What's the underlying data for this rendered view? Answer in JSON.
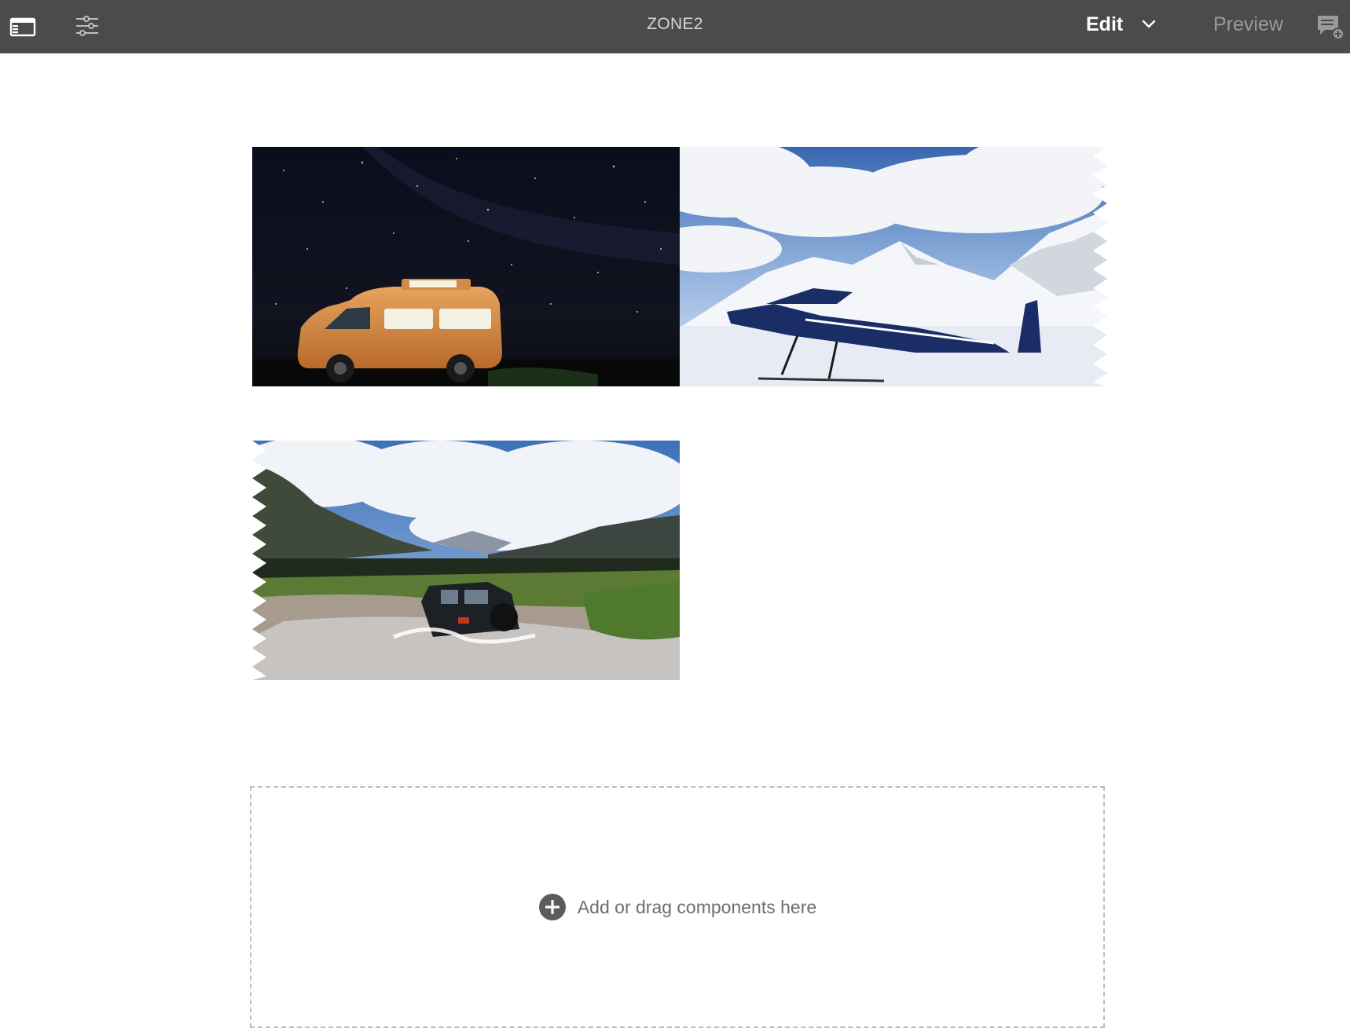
{
  "topbar": {
    "sidebar_icon": "toggle-side-panel-icon",
    "properties_icon": "page-properties-sliders-icon",
    "title": "ZONE2",
    "mode_label": "Edit",
    "mode_dropdown_icon": "chevron-down-icon",
    "preview_label": "Preview",
    "annotate_icon": "annotate-add-icon"
  },
  "images": [
    {
      "name": "camper-van-night",
      "alt": "Orange camper van under starry night sky"
    },
    {
      "name": "seaplane-glacier",
      "alt": "Blue bush plane on snowy glacier below mountains"
    },
    {
      "name": "suv-river-crossing",
      "alt": "SUV driving through a river in a mountain valley"
    }
  ],
  "dropzone": {
    "icon": "add-circle-icon",
    "label": "Add or drag components here"
  },
  "colors": {
    "topbar_bg": "#4b4b4b",
    "canvas_bg": "#ffffff",
    "placeholder_border": "#bdbdbd",
    "placeholder_text": "#6e6e6e"
  }
}
